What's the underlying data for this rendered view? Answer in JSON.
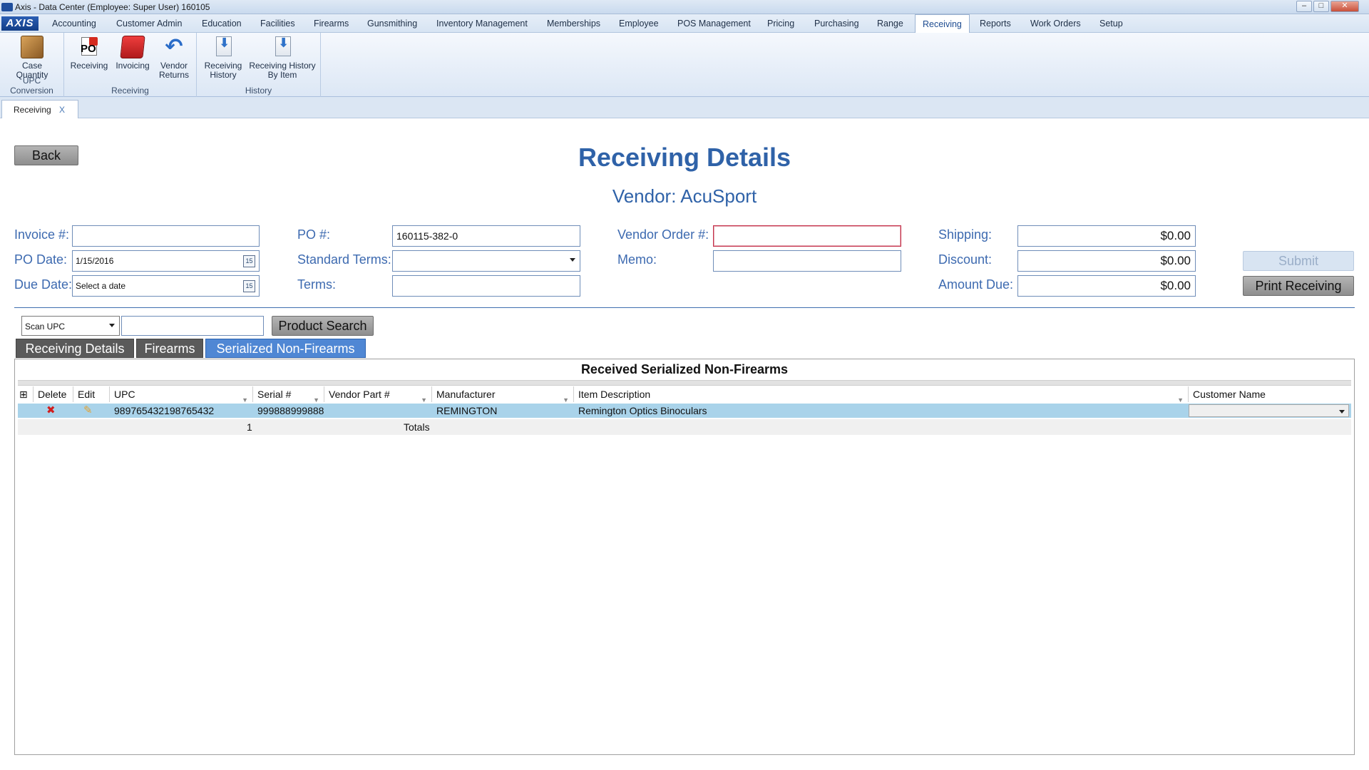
{
  "window": {
    "title": "Axis - Data Center  (Employee: Super User) 160105",
    "controls": {
      "minimize": "‒",
      "maximize": "□",
      "close": "✕"
    }
  },
  "menu": {
    "logo": "AXIS",
    "items": [
      "Accounting",
      "Customer Admin",
      "Education",
      "Facilities",
      "Firearms",
      "Gunsmithing",
      "Inventory Management",
      "Memberships",
      "Employee",
      "POS Management",
      "Pricing",
      "Purchasing",
      "Range",
      "Receiving",
      "Reports",
      "Work Orders",
      "Setup"
    ],
    "active": "Receiving"
  },
  "ribbon": {
    "groups": [
      {
        "label": "UPC Conversion",
        "buttons": [
          {
            "line1": "Case",
            "line2": "Quantity",
            "icon": "box-icon"
          }
        ]
      },
      {
        "label": "Receiving",
        "buttons": [
          {
            "line1": "Receiving",
            "line2": "",
            "icon": "po-icon"
          },
          {
            "line1": "Invoicing",
            "line2": "",
            "icon": "folder-icon"
          },
          {
            "line1": "Vendor",
            "line2": "Returns",
            "icon": "undo-icon"
          }
        ]
      },
      {
        "label": "History",
        "buttons": [
          {
            "line1": "Receiving",
            "line2": "History",
            "icon": "history-icon"
          },
          {
            "line1": "Receiving History",
            "line2": "By Item",
            "icon": "history-icon"
          }
        ]
      }
    ]
  },
  "doc_tab": {
    "label": "Receiving",
    "close": "X"
  },
  "page": {
    "back_label": "Back",
    "title": "Receiving Details",
    "vendor": "Vendor: AcuSport"
  },
  "form": {
    "invoice_label": "Invoice #:",
    "invoice_value": "",
    "po_date_label": "PO Date:",
    "po_date_value": "1/15/2016",
    "due_date_label": "Due Date:",
    "due_date_value": "Select a date",
    "po_label": "PO #:",
    "po_value": "160115-382-0",
    "std_terms_label": "Standard Terms:",
    "std_terms_value": "",
    "terms_label": "Terms:",
    "terms_value": "",
    "vendor_order_label": "Vendor Order #:",
    "vendor_order_value": "",
    "memo_label": "Memo:",
    "memo_value": "",
    "shipping_label": "Shipping:",
    "shipping_value": "$0.00",
    "discount_label": "Discount:",
    "discount_value": "$0.00",
    "amount_due_label": "Amount Due:",
    "amount_due_value": "$0.00",
    "submit_label": "Submit",
    "print_label": "Print Receiving",
    "calendar_glyph": "15"
  },
  "search": {
    "mode": "Scan UPC",
    "value": "",
    "button_label": "Product Search"
  },
  "tabs": [
    "Receiving Details",
    "Firearms",
    "Serialized Non-Firearms"
  ],
  "active_tab": "Serialized Non-Firearms",
  "grid": {
    "title": "Received Serialized Non-Firearms",
    "columns": [
      "Delete",
      "Edit",
      "UPC",
      "Serial #",
      "Vendor Part #",
      "Manufacturer",
      "Item Description",
      "Customer Name"
    ],
    "rows": [
      {
        "upc": "989765432198765432",
        "serial": "999888999888",
        "vendor_part": "",
        "manufacturer": "REMINGTON",
        "description": "Remington Optics Binoculars",
        "customer": ""
      }
    ],
    "totals": {
      "count": "1",
      "label": "Totals"
    }
  },
  "colors": {
    "accent": "#2f62a8",
    "active_tab": "#4f87d4",
    "row_highlight": "#a9d3ea",
    "required_border": "#c5304a"
  }
}
